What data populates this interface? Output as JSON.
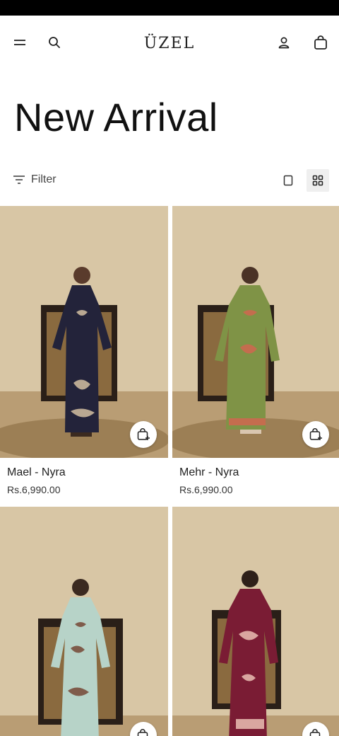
{
  "header": {
    "logo_text": "ÜZEL",
    "icons": [
      "menu-icon",
      "search-icon",
      "account-icon",
      "cart-icon"
    ]
  },
  "page": {
    "title": "New Arrival"
  },
  "toolbar": {
    "filter_label": "Filter"
  },
  "products": [
    {
      "name": "Mael - Nyra",
      "price": "Rs.6,990.00",
      "dress_color": "#23233a",
      "pattern_color": "#b9a892"
    },
    {
      "name": "Mehr - Nyra",
      "price": "Rs.6,990.00",
      "dress_color": "#7f9346",
      "pattern_color": "#c46d4e"
    },
    {
      "name": "",
      "price": "",
      "dress_color": "#b7d3c8",
      "pattern_color": "#7f5c4b"
    },
    {
      "name": "",
      "price": "",
      "dress_color": "#7a1c34",
      "pattern_color": "#d9a6a0"
    }
  ],
  "colors": {
    "wall": "#d8c6a5",
    "floor": "#b99d74",
    "cabinet": "#2a1f18",
    "cane": "#8a6a3f"
  }
}
